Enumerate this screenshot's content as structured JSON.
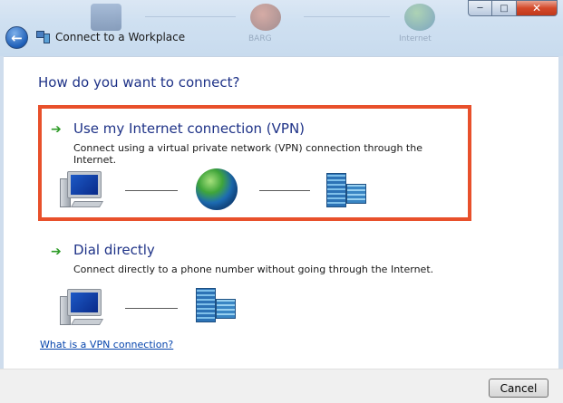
{
  "window": {
    "title": "Connect to a Workplace",
    "controls": {
      "minimize": "─",
      "maximize": "□",
      "close": "✕"
    },
    "back_icon": "←",
    "background_labels": [
      "BARG",
      "Internet"
    ]
  },
  "main": {
    "heading": "How do you want to connect?",
    "options": [
      {
        "arrow": "➔",
        "title": "Use my Internet connection (VPN)",
        "description": "Connect using a virtual private network (VPN) connection through the Internet.",
        "icons": [
          "computer-icon",
          "globe-icon",
          "building-icon"
        ],
        "highlighted": true
      },
      {
        "arrow": "➔",
        "title": "Dial directly",
        "description": "Connect directly to a phone number without going through the Internet.",
        "icons": [
          "computer-icon",
          "building-icon"
        ]
      }
    ],
    "help_link": "What is a VPN connection?"
  },
  "footer": {
    "cancel_label": "Cancel"
  },
  "colors": {
    "heading": "#1e3287",
    "highlight_border": "#e8502b",
    "arrow": "#2e9b27",
    "link": "#0645ad"
  }
}
